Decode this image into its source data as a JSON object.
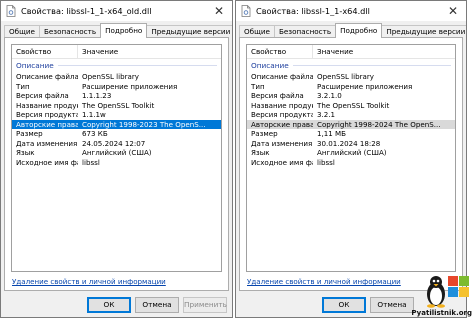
{
  "left": {
    "title": "Свойства: libssl-1_1-x64_old.dll",
    "tabs": [
      "Общие",
      "Безопасность",
      "Подробно",
      "Предыдущие версии"
    ],
    "active_tab": 2,
    "columns": [
      "Свойство",
      "Значение"
    ],
    "group": "Описание",
    "rows": [
      {
        "k": "Описание файла",
        "v": "OpenSSL library"
      },
      {
        "k": "Тип",
        "v": "Расширение приложения"
      },
      {
        "k": "Версия файла",
        "v": "1.1.1.23"
      },
      {
        "k": "Название продукта",
        "v": "The OpenSSL Toolkit"
      },
      {
        "k": "Версия продукта",
        "v": "1.1.1w"
      },
      {
        "k": "Авторские права",
        "v": "Copyright 1998-2023 The OpenS..."
      },
      {
        "k": "Размер",
        "v": "673 КБ"
      },
      {
        "k": "Дата изменения",
        "v": "24.05.2024 12:07"
      },
      {
        "k": "Язык",
        "v": "Английский (США)"
      },
      {
        "k": "Исходное имя файла",
        "v": "libssl"
      }
    ],
    "link": "Удаление свойств и личной информации",
    "buttons": {
      "ok": "ОК",
      "cancel": "Отмена",
      "apply": "Применить"
    }
  },
  "right": {
    "title": "Свойства: libssl-1_1-x64.dll",
    "tabs": [
      "Общие",
      "Безопасность",
      "Подробно",
      "Предыдущие версии"
    ],
    "active_tab": 2,
    "columns": [
      "Свойство",
      "Значение"
    ],
    "group": "Описание",
    "rows": [
      {
        "k": "Описание файла",
        "v": "OpenSSL library"
      },
      {
        "k": "Тип",
        "v": "Расширение приложения"
      },
      {
        "k": "Версия файла",
        "v": "3.2.1.0"
      },
      {
        "k": "Название продукта",
        "v": "The OpenSSL Toolkit"
      },
      {
        "k": "Версия продукта",
        "v": "3.2.1"
      },
      {
        "k": "Авторские права",
        "v": "Copyright 1998-2024 The OpenS..."
      },
      {
        "k": "Размер",
        "v": "1,11 МБ"
      },
      {
        "k": "Дата изменения",
        "v": "30.01.2024 18:28"
      },
      {
        "k": "Язык",
        "v": "Английский (США)"
      },
      {
        "k": "Исходное имя файла",
        "v": "libssl"
      }
    ],
    "link": "Удаление свойств и личной информации",
    "buttons": {
      "ok": "ОК",
      "cancel": "Отмена"
    }
  },
  "watermark": {
    "text": "Pyatilistnik.org",
    "icon": "windows-logo-icon"
  },
  "colors": {
    "selection": "#0078d7",
    "link": "#0645ad",
    "group": "#1e3f9e"
  }
}
